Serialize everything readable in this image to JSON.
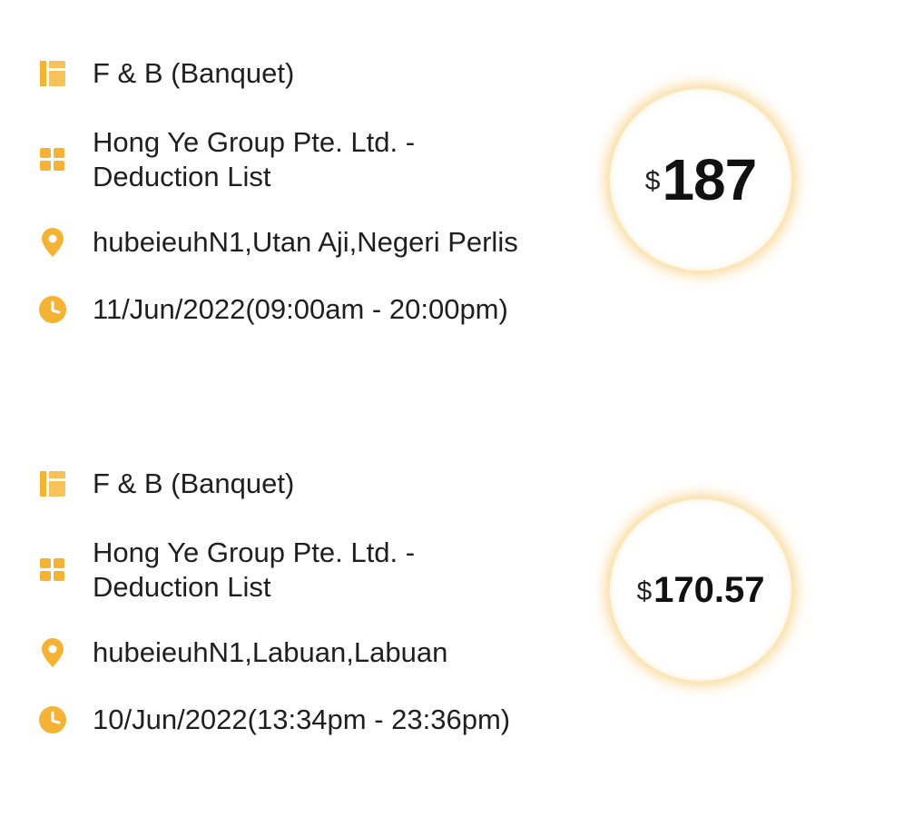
{
  "accent_color": "#F5B335",
  "jobs": [
    {
      "category": "F & B (Banquet)",
      "company": "Hong Ye Group Pte. Ltd. -\nDeduction List",
      "location": "hubeieuhN1,Utan Aji,Negeri Perlis",
      "time": "11/Jun/2022(09:00am - 20:00pm)",
      "currency": "$",
      "amount": "187",
      "icons": [
        "category-icon",
        "company-icon",
        "location-pin-icon",
        "clock-icon"
      ]
    },
    {
      "category": "F & B (Banquet)",
      "company": "Hong Ye Group Pte. Ltd. -\nDeduction List",
      "location": "hubeieuhN1,Labuan,Labuan",
      "time": "10/Jun/2022(13:34pm - 23:36pm)",
      "currency": "$",
      "amount": "170.57",
      "icons": [
        "category-icon",
        "company-icon",
        "location-pin-icon",
        "clock-icon"
      ]
    }
  ]
}
